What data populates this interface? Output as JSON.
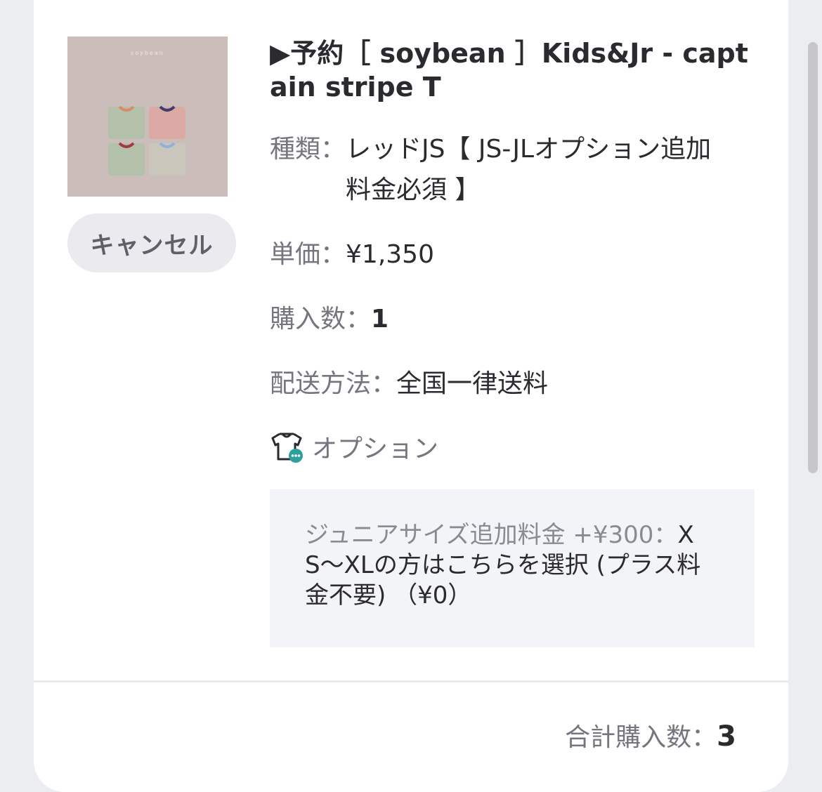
{
  "product": {
    "image_alt": "soybean captain stripe T product photo",
    "image_brand_text": "soybean",
    "title": "▶予約［ soybean ］Kids&Jr - captain stripe T",
    "cancel_label": "キャンセル",
    "type_label": "種類：",
    "type_value": "レッドJS【 JS-JLオプション追加料金必須 】",
    "price_label": "単価：",
    "price_value": "¥1,350",
    "quantity_label": "購入数：",
    "quantity_value": "1",
    "shipping_label": "配送方法：",
    "shipping_value": "全国一律送料",
    "option_icon": "tshirt-options-icon",
    "option_heading": "オプション",
    "option_name": "ジュニアサイズ追加料金 +¥300：",
    "option_value": "XS〜XLの方はこちらを選択 (プラス料金不要) （¥0）"
  },
  "summary": {
    "total_quantity_label": "合計購入数：",
    "total_quantity_value": "3"
  },
  "colors": {
    "background": "#ecedf1",
    "card": "#ffffff",
    "text": "#2b2b2f",
    "label": "#75757d",
    "option_box": "#f3f4f7",
    "cancel_bg": "#ebebef",
    "icon_accent": "#2aa19c"
  }
}
